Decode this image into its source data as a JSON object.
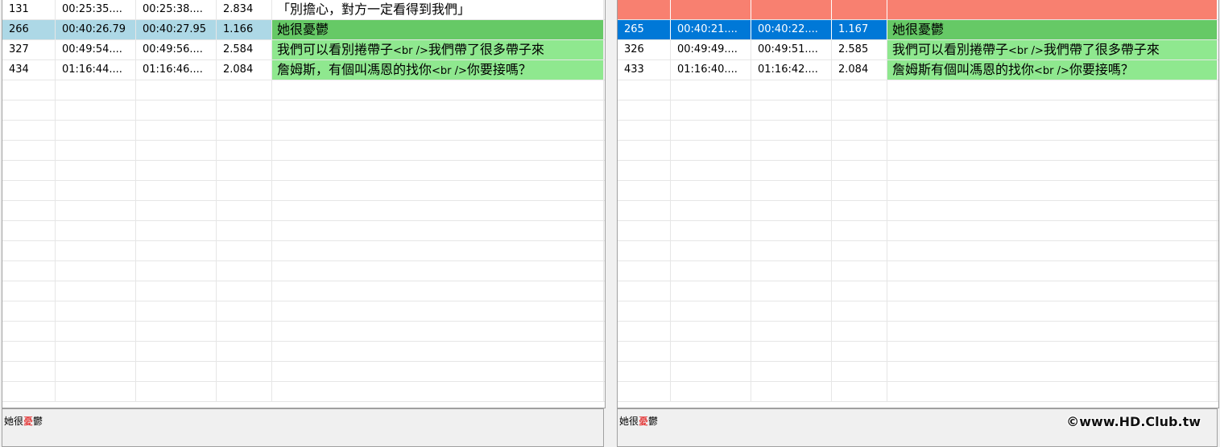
{
  "colors": {
    "row_sync_selected": "#add8e6",
    "row_selected": "#0078d7",
    "row_match": "#8fe88f",
    "row_match_strong": "#66c966",
    "row_missing": "#f88070",
    "grid_line": "#e6e6e6"
  },
  "left": {
    "rows": [
      {
        "num": "131",
        "start": "00:25:35....",
        "end": "00:25:38....",
        "dur": "2.834",
        "text": "「別擔心，對方一定看得到我們」",
        "state": "none"
      },
      {
        "num": "266",
        "start": "00:40:26.79",
        "end": "00:40:27.95",
        "dur": "1.166",
        "text": "她很憂鬱",
        "state": "sync"
      },
      {
        "num": "327",
        "start": "00:49:54....",
        "end": "00:49:56....",
        "dur": "2.584",
        "text": "我們可以看別捲帶子<br />我們帶了很多帶子來",
        "state": "match"
      },
      {
        "num": "434",
        "start": "01:16:44....",
        "end": "01:16:46....",
        "dur": "2.084",
        "text": "詹姆斯，有個叫馮恩的找你<br />你要接嗎？",
        "state": "match"
      }
    ],
    "preview": {
      "before": "她很",
      "highlight": "憂",
      "after": "鬱"
    }
  },
  "right": {
    "rows": [
      {
        "num": "",
        "start": "",
        "end": "",
        "dur": "",
        "text": "",
        "state": "missing"
      },
      {
        "num": "265",
        "start": "00:40:21....",
        "end": "00:40:22....",
        "dur": "1.167",
        "text": "她很憂鬱",
        "state": "selected"
      },
      {
        "num": "326",
        "start": "00:49:49....",
        "end": "00:49:51....",
        "dur": "2.585",
        "text": "我們可以看別捲帶子<br />我們帶了很多帶子來",
        "state": "match"
      },
      {
        "num": "433",
        "start": "01:16:40....",
        "end": "01:16:42....",
        "dur": "2.084",
        "text": "詹姆斯有個叫馮恩的找你<br />你要接嗎？",
        "state": "match"
      }
    ],
    "preview": {
      "before": "她很",
      "highlight": "憂",
      "after": "鬱"
    },
    "watermark": "©www.HD.Club.tw"
  }
}
